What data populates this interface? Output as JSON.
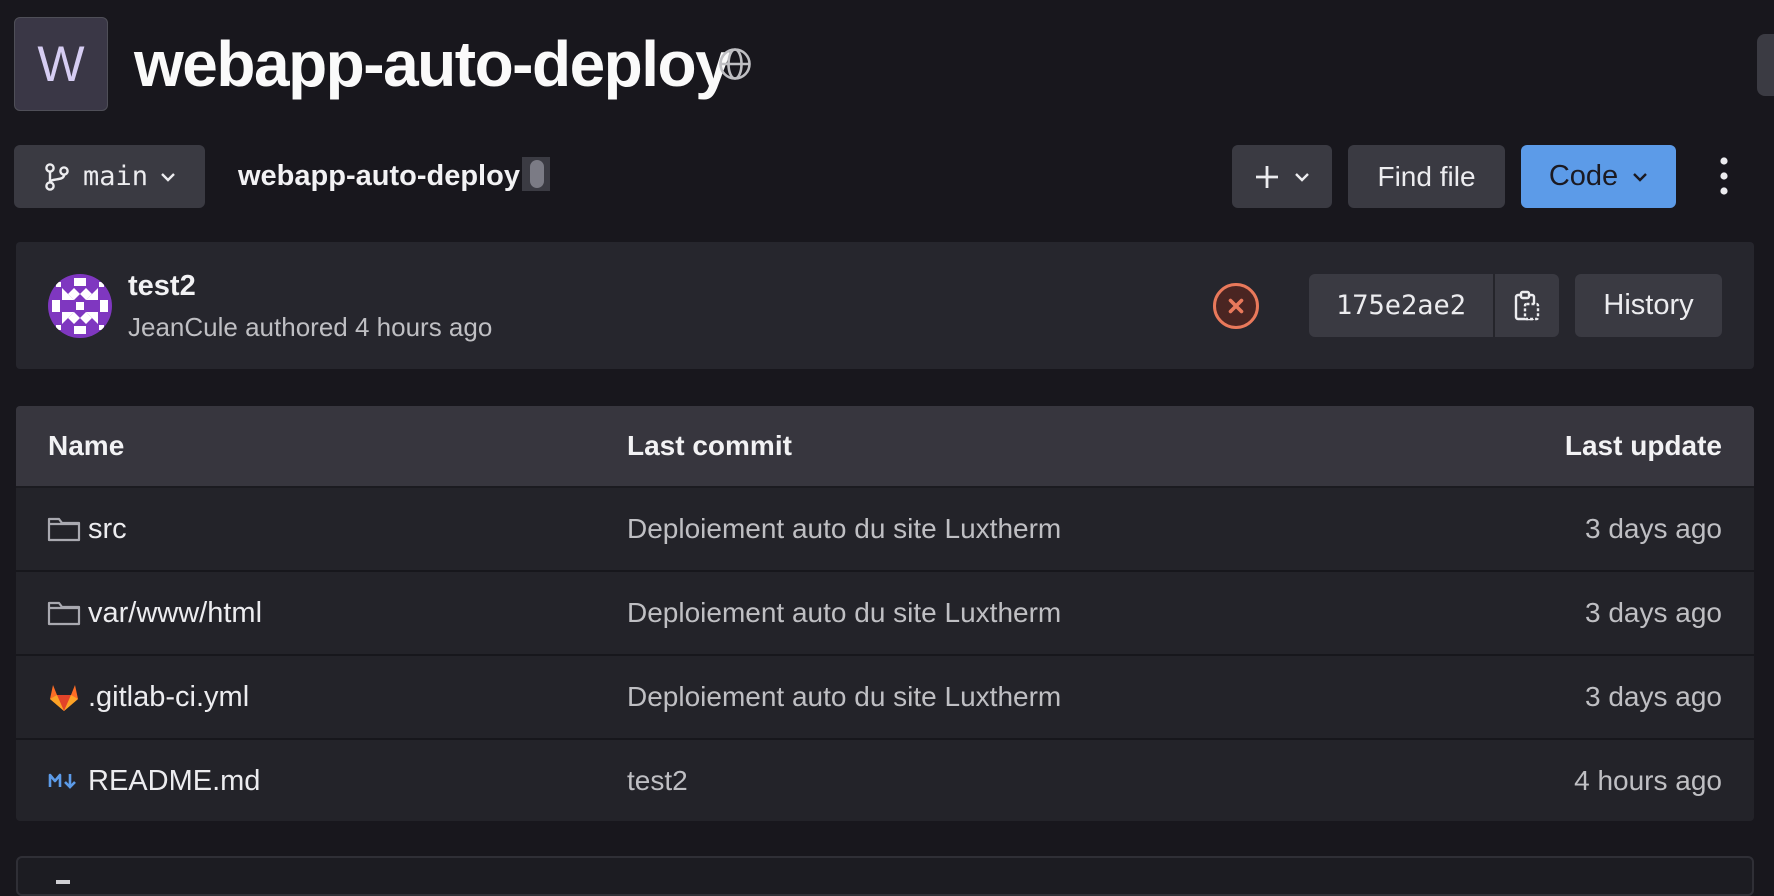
{
  "project": {
    "avatar_letter": "W",
    "name": "webapp-auto-deploy",
    "visibility_icon": "globe-icon"
  },
  "toolbar": {
    "branch": "main",
    "breadcrumb": "webapp-auto-deploy",
    "add_icon": "plus-icon",
    "find_file_label": "Find file",
    "code_label": "Code",
    "more_icon": "kebab-icon"
  },
  "last_commit": {
    "title": "test2",
    "author": "JeanCule",
    "action": "authored",
    "time": "4 hours ago",
    "pipeline_status": "failed",
    "sha": "175e2ae2",
    "history_label": "History"
  },
  "files": {
    "headers": {
      "name": "Name",
      "last_commit": "Last commit",
      "last_update": "Last update"
    },
    "rows": [
      {
        "icon": "folder-icon",
        "name": "src",
        "commit": "Deploiement auto du site Luxtherm",
        "updated": "3 days ago"
      },
      {
        "icon": "folder-icon",
        "name": "var/www/html",
        "commit": "Deploiement auto du site Luxtherm",
        "updated": "3 days ago"
      },
      {
        "icon": "gitlab-icon",
        "name": ".gitlab-ci.yml",
        "commit": "Deploiement auto du site Luxtherm",
        "updated": "3 days ago"
      },
      {
        "icon": "markdown-icon",
        "name": "README.md",
        "commit": "test2",
        "updated": "4 hours ago"
      }
    ]
  },
  "colors": {
    "background": "#18171d",
    "accent": "#5c9be8",
    "error": "#e9795b",
    "avatar_purple": "#7f37c0"
  }
}
